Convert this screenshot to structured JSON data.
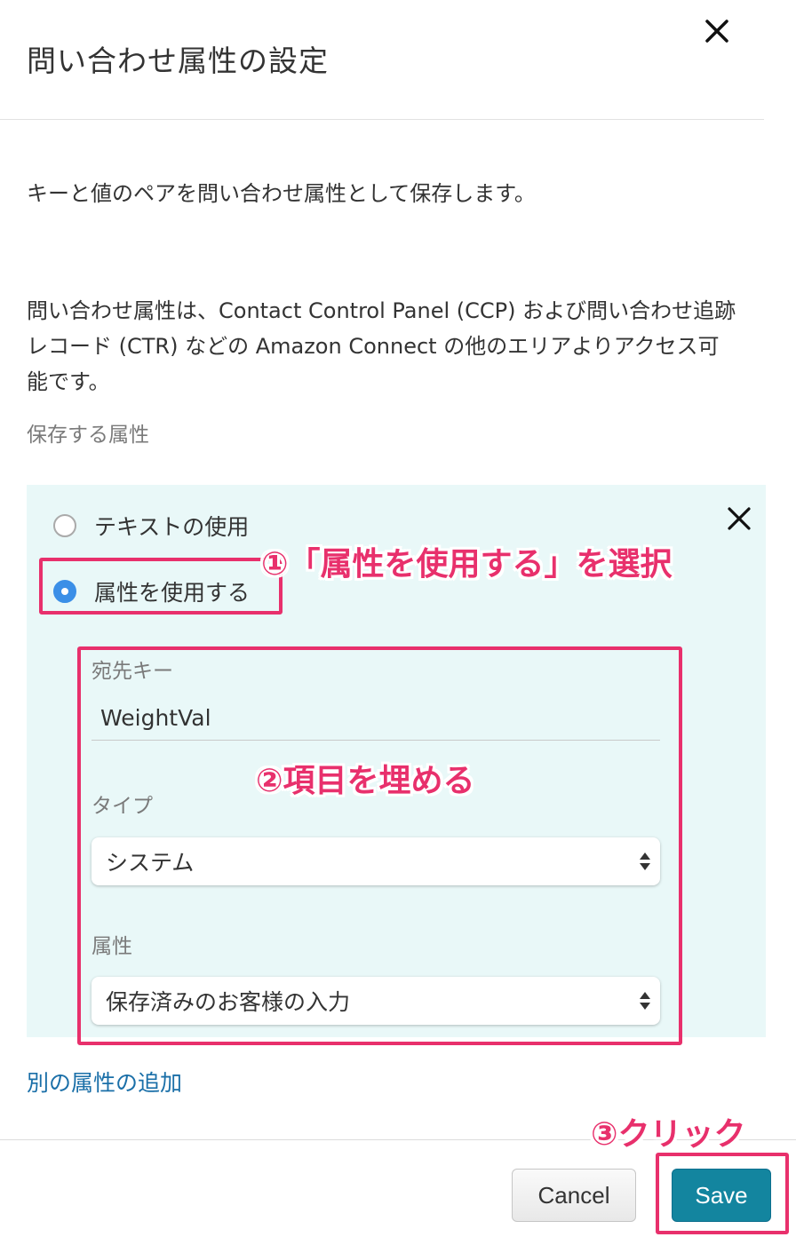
{
  "dialog": {
    "title": "問い合わせ属性の設定",
    "description1": "キーと値のペアを問い合わせ属性として保存します。",
    "description2": "問い合わせ属性は、Contact Control Panel (CCP) および問い合わせ追跡レコード (CTR) などの Amazon Connect の他のエリアよりアクセス可能です。",
    "section_label": "保存する属性"
  },
  "attribute_panel": {
    "radio_options": [
      {
        "label": "テキストの使用",
        "selected": false
      },
      {
        "label": "属性を使用する",
        "selected": true
      }
    ],
    "destination_key": {
      "label": "宛先キー",
      "value": "WeightVal"
    },
    "type": {
      "label": "タイプ",
      "value": "システム"
    },
    "attribute": {
      "label": "属性",
      "value": "保存済みのお客様の入力"
    }
  },
  "add_attribute_link": "別の属性の追加",
  "footer": {
    "cancel_label": "Cancel",
    "save_label": "Save"
  },
  "annotations": {
    "step1": "①「属性を使用する」を選択",
    "step2": "②項目を埋める",
    "step3": "③クリック",
    "highlight_color": "#e8306c"
  },
  "colors": {
    "panel_bg": "#e9f8f8",
    "save_button": "#13859f",
    "link": "#1a6fa8",
    "radio_selected": "#3b8fe7"
  },
  "icons": {
    "dialog_close": "close-icon",
    "panel_close": "close-icon",
    "select_arrows": "updown-arrows-icon"
  }
}
